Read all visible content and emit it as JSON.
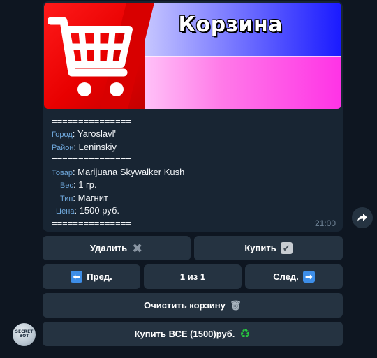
{
  "message": {
    "banner": {
      "title": "Корзина",
      "cart_icon": "shopping-cart-icon"
    },
    "separator": "===============",
    "city": {
      "label": "Город",
      "value": ": Yaroslavl'"
    },
    "district": {
      "label": "Район",
      "value": ": Leninskiy"
    },
    "product": {
      "label": "Товар",
      "value": ": Marijuana Skywalker Kush"
    },
    "weight": {
      "label": "Вес",
      "value": ": 1 гр."
    },
    "type": {
      "label": "Тип",
      "value": ": Магнит"
    },
    "price": {
      "label": "Цена",
      "value": ": 1500 руб."
    },
    "time": "21:00"
  },
  "keyboard": {
    "delete": {
      "label": "Удалить",
      "icon": "✖"
    },
    "buy": {
      "label": "Купить",
      "icon": "✔"
    },
    "prev": {
      "label": "Пред.",
      "icon": "⬅"
    },
    "pager": {
      "label": "1 из 1"
    },
    "next": {
      "label": "След.",
      "icon": "➡"
    },
    "clear": {
      "label": "Очистить корзину",
      "icon": "🗑"
    },
    "buy_all": {
      "label": "Купить ВСЕ (1500)руб.",
      "icon": "♻"
    }
  },
  "avatar": {
    "text": "SECRET BOT"
  },
  "colors": {
    "background": "#0e1621",
    "bubble": "#182533",
    "button": "#253341",
    "label": "#6fa8dc"
  }
}
